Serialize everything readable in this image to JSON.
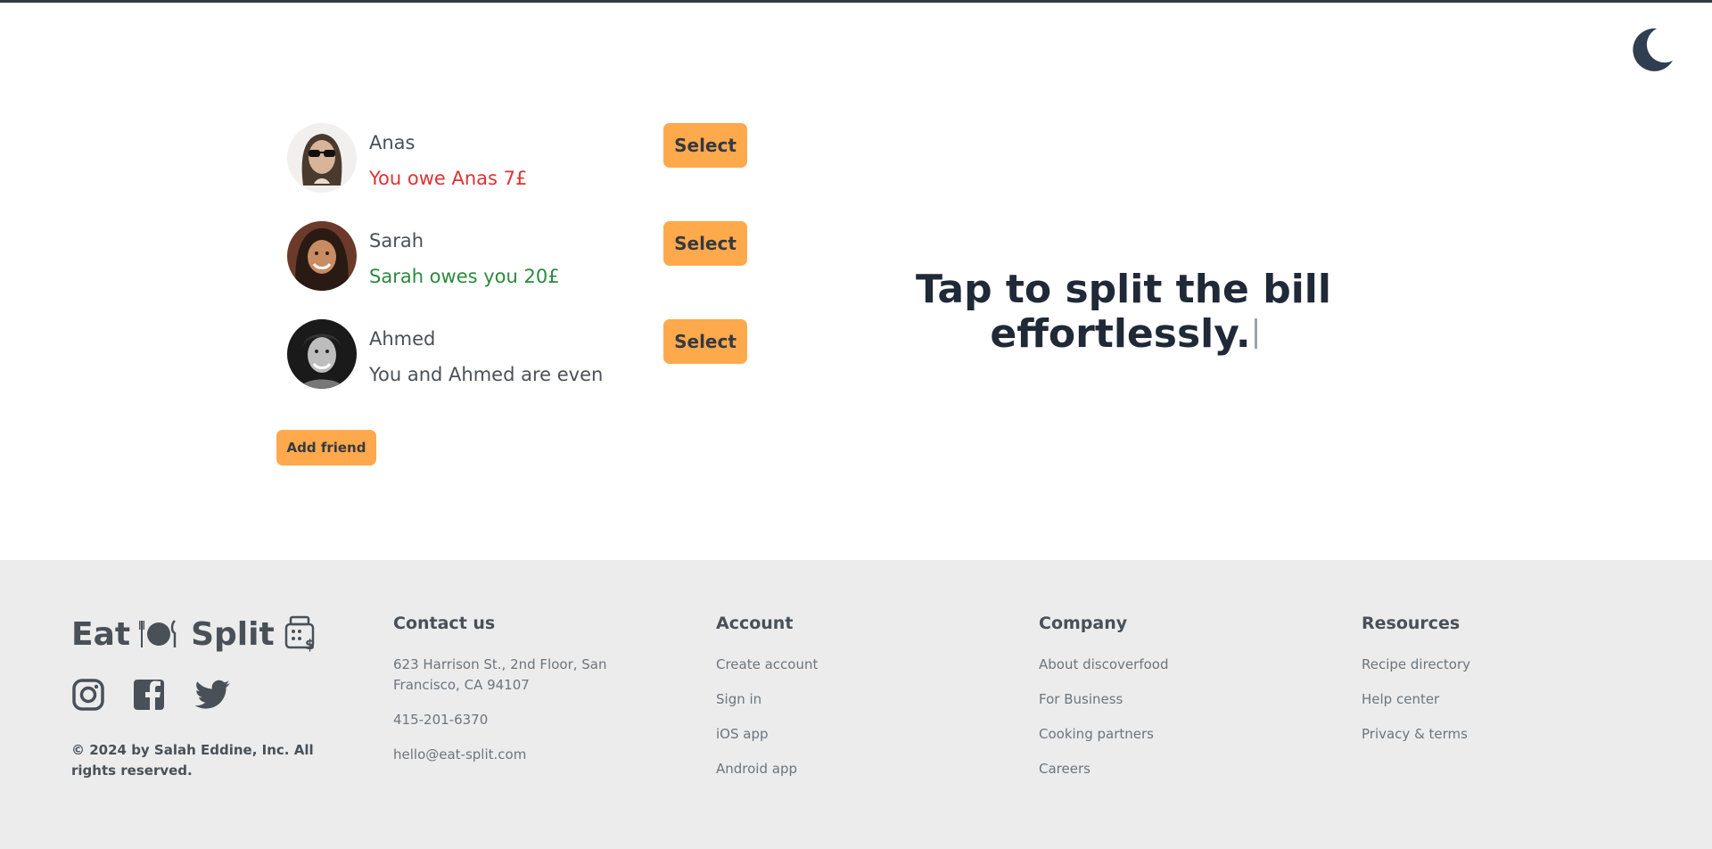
{
  "friends": [
    {
      "name": "Anas",
      "balance": "You owe Anas 7£",
      "status": "owe",
      "select_label": "Select"
    },
    {
      "name": "Sarah",
      "balance": "Sarah owes you 20£",
      "status": "owed",
      "select_label": "Select"
    },
    {
      "name": "Ahmed",
      "balance": "You and Ahmed are even",
      "status": "even",
      "select_label": "Select"
    }
  ],
  "add_friend_label": "Add friend",
  "headline": {
    "line1": "Tap to split the bill",
    "line2": "effortlessly."
  },
  "theme_toggle_icon": "moon-icon",
  "colors": {
    "accent": "#ffa94d",
    "owe": "#e03131",
    "owed": "#2b8a3e",
    "footer_bg": "#ececec"
  },
  "footer": {
    "logo": {
      "word1": "Eat",
      "word2": "Split",
      "icon1": "plate-cutlery-icon",
      "icon2": "calculator-dollar-icon"
    },
    "socials": [
      "instagram-icon",
      "facebook-icon",
      "twitter-icon"
    ],
    "copyright": "© 2024 by Salah Eddine, Inc. All rights reserved.",
    "contact": {
      "title": "Contact us",
      "address": "623 Harrison St., 2nd Floor, San Francisco, CA 94107",
      "phone": "415-201-6370",
      "email": "hello@eat-split.com"
    },
    "account": {
      "title": "Account",
      "links": [
        "Create account",
        "Sign in",
        "iOS app",
        "Android app"
      ]
    },
    "company": {
      "title": "Company",
      "links": [
        "About discoverfood",
        "For Business",
        "Cooking partners",
        "Careers"
      ]
    },
    "resources": {
      "title": "Resources",
      "links": [
        "Recipe directory",
        "Help center",
        "Privacy & terms"
      ]
    }
  }
}
